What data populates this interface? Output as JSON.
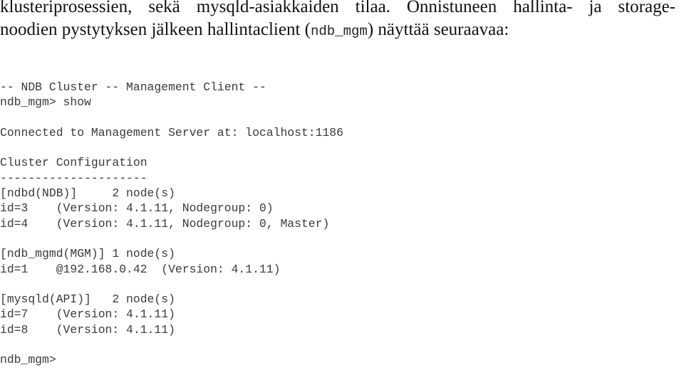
{
  "paragraph": {
    "line1": "klusteriprosessien, sekä mysqld-asiakkaiden tilaa. Onnistuneen hallinta- ja storage-",
    "line2_before": "noodien pystytyksen jälkeen hallintaclient (",
    "line2_code": "ndb_mgm",
    "line2_after": ") näyttää seuraavaa:"
  },
  "terminal": {
    "lines": [
      "-- NDB Cluster -- Management Client --",
      "ndb_mgm> show",
      "",
      "Connected to Management Server at: localhost:1186",
      "",
      "Cluster Configuration",
      "---------------------",
      "[ndbd(NDB)]     2 node(s)",
      "id=3    (Version: 4.1.11, Nodegroup: 0)",
      "id=4    (Version: 4.1.11, Nodegroup: 0, Master)",
      "",
      "[ndb_mgmd(MGM)] 1 node(s)",
      "id=1    @192.168.0.42  (Version: 4.1.11)",
      "",
      "[mysqld(API)]   2 node(s)",
      "id=7    (Version: 4.1.11)",
      "id=8    (Version: 4.1.11)",
      "",
      "ndb_mgm>"
    ]
  }
}
